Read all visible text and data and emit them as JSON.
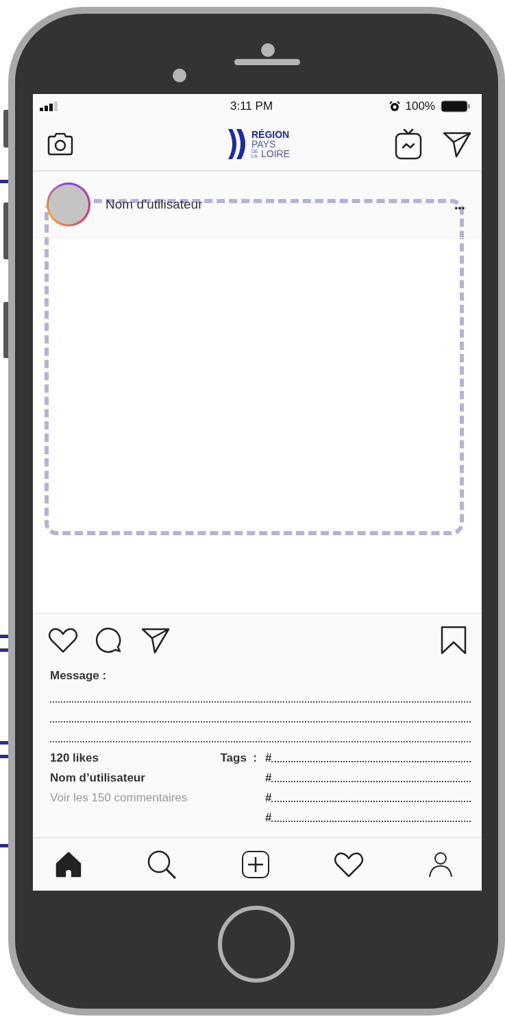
{
  "status_bar": {
    "time": "3:11 PM",
    "battery": "100%"
  },
  "header": {
    "logo": {
      "top": "RÉGION",
      "middle": "PAYS",
      "small": "DE LA",
      "bottom": "LOIRE"
    }
  },
  "post": {
    "username": "Nom d’utilisateur",
    "more": "...",
    "message_label": "Message :",
    "likes": "120 likes",
    "owner": "Nom d’utilisateur",
    "comments": "Voir les 150 commentaires",
    "tags_label": "Tags  :",
    "tags": [
      "#",
      "#",
      "#",
      "#"
    ]
  },
  "bottom_nav": [
    {
      "kind": "home",
      "selected": true
    },
    {
      "kind": "search",
      "selected": false
    },
    {
      "kind": "add",
      "selected": false
    },
    {
      "kind": "heart",
      "selected": false
    },
    {
      "kind": "profile",
      "selected": false
    }
  ]
}
